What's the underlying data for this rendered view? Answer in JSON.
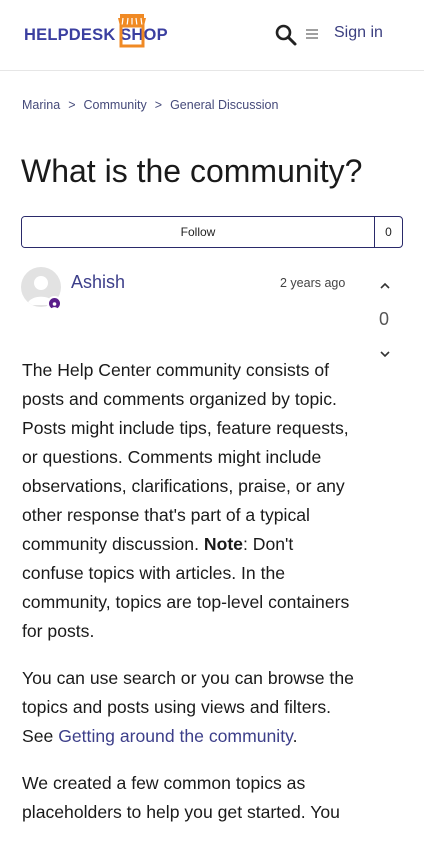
{
  "header": {
    "logo_text": "HELPDESK SHOP",
    "sign_in_label": "Sign in",
    "icons": {
      "search": "search-icon",
      "menu": "menu-icon",
      "logo_shop": "shop-awning-icon"
    }
  },
  "breadcrumb": {
    "items": [
      "Marina",
      "Community",
      "General Discussion"
    ],
    "separator": ">"
  },
  "post": {
    "title": "What is the community?",
    "follow_label": "Follow",
    "follow_count": "0",
    "author": "Ashish",
    "timestamp": "2 years ago",
    "vote_count": "0",
    "paragraph1_a": "The Help Center community consists of posts and comments organized by topic. Posts might include tips, feature requests, or questions. Comments might include observations, clarifications, praise, or any other response that's part of a typical community discussion. ",
    "paragraph1_bold": "Note",
    "paragraph1_b": ": Don't confuse topics with articles. In the community, topics are top-level containers for posts.",
    "paragraph2_a": "You can use search or you can browse the topics and posts using views and filters. See ",
    "paragraph2_link": "Getting around the community",
    "paragraph2_b": ".",
    "paragraph3": "We created a few common topics as placeholders to help you get started. You"
  },
  "colors": {
    "brand": "#3b3fa0",
    "logo_accent": "#f08a24",
    "link": "#3d3f8a",
    "badge": "#5a1e8a",
    "border": "#2a2a6a"
  }
}
